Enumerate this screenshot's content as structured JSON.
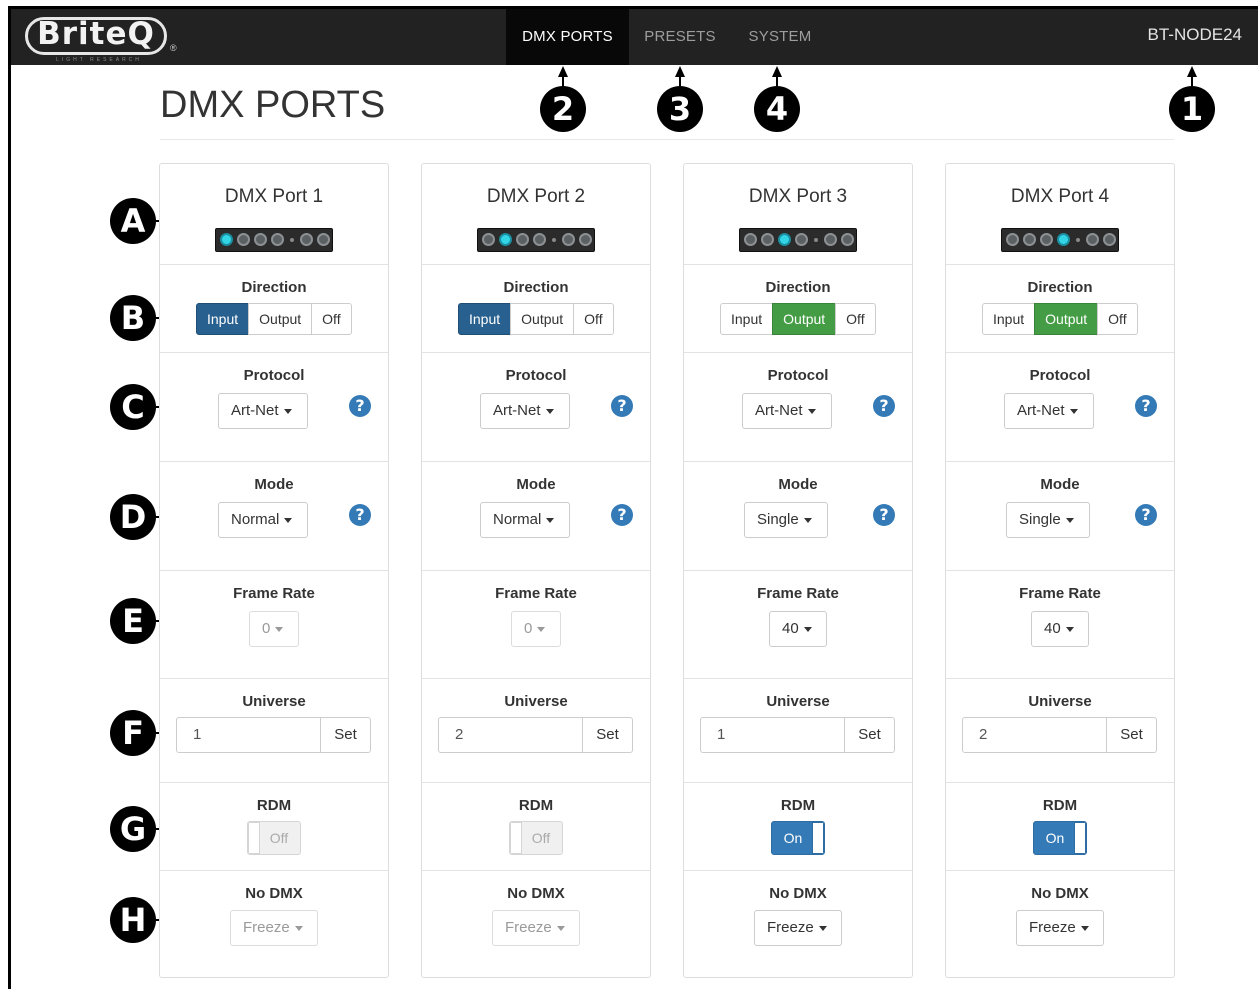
{
  "nav": {
    "logo_text": "BriteQ",
    "logo_sub": "LIGHT RESEARCH",
    "logo_reg": "®",
    "tabs": [
      {
        "label": "DMX PORTS",
        "active": true
      },
      {
        "label": "PRESETS",
        "active": false
      },
      {
        "label": "SYSTEM",
        "active": false
      }
    ],
    "device_name": "BT-NODE24"
  },
  "page": {
    "title": "DMX PORTS"
  },
  "callouts": {
    "top": [
      "1",
      "2",
      "3",
      "4"
    ],
    "side": [
      "A",
      "B",
      "C",
      "D",
      "E",
      "F",
      "G",
      "H"
    ]
  },
  "labels": {
    "direction": "Direction",
    "protocol": "Protocol",
    "mode": "Mode",
    "frame_rate": "Frame Rate",
    "universe": "Universe",
    "rdm": "RDM",
    "no_dmx": "No DMX",
    "set": "Set",
    "input": "Input",
    "output": "Output",
    "off": "Off",
    "help": "?"
  },
  "ports": [
    {
      "title": "DMX Port 1",
      "active_led": 1,
      "direction": "Input",
      "protocol": "Art-Net",
      "mode": "Normal",
      "frame_rate": "0",
      "frame_rate_enabled": false,
      "universe": "1",
      "rdm": "Off",
      "no_dmx": "Freeze",
      "no_dmx_enabled": false
    },
    {
      "title": "DMX Port 2",
      "active_led": 2,
      "direction": "Input",
      "protocol": "Art-Net",
      "mode": "Normal",
      "frame_rate": "0",
      "frame_rate_enabled": false,
      "universe": "2",
      "rdm": "Off",
      "no_dmx": "Freeze",
      "no_dmx_enabled": false
    },
    {
      "title": "DMX Port 3",
      "active_led": 3,
      "direction": "Output",
      "protocol": "Art-Net",
      "mode": "Single",
      "frame_rate": "40",
      "frame_rate_enabled": true,
      "universe": "1",
      "rdm": "On",
      "no_dmx": "Freeze",
      "no_dmx_enabled": true
    },
    {
      "title": "DMX Port 4",
      "active_led": 4,
      "direction": "Output",
      "protocol": "Art-Net",
      "mode": "Single",
      "frame_rate": "40",
      "frame_rate_enabled": true,
      "universe": "2",
      "rdm": "On",
      "no_dmx": "Freeze",
      "no_dmx_enabled": true
    }
  ],
  "colors": {
    "navbar": "#222222",
    "input_selected": "#286090",
    "output_selected": "#449d44",
    "rdm_on": "#337ab7",
    "help_icon": "#337ab7"
  }
}
